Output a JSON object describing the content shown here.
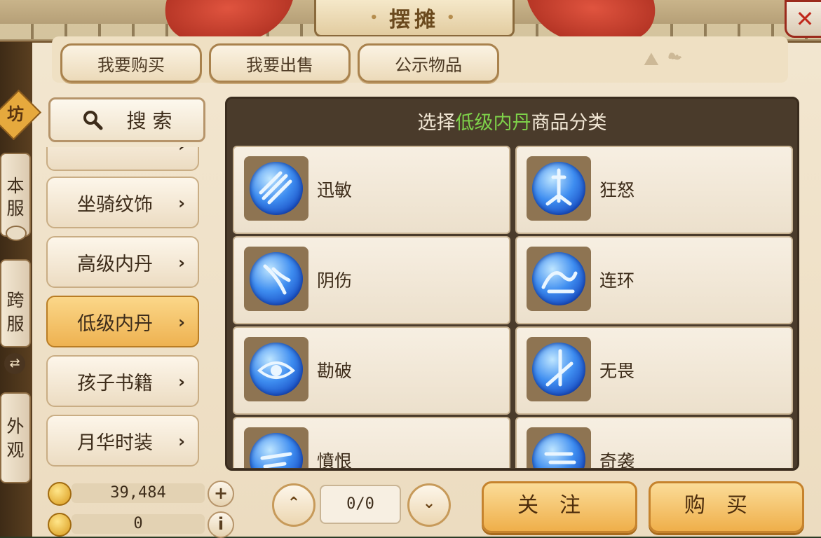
{
  "header": {
    "title": "摆摊",
    "close_symbol": "✕"
  },
  "top_tabs": [
    {
      "label": "我要购买"
    },
    {
      "label": "我要出售"
    },
    {
      "label": "公示物品"
    }
  ],
  "side_tabs": {
    "shop": "坊",
    "local": "本服",
    "cross": "跨服",
    "appearance": "外观"
  },
  "search": {
    "label": "搜 索"
  },
  "categories": [
    {
      "label": "坐骑纹饰"
    },
    {
      "label": "高级内丹"
    },
    {
      "label": "低级内丹"
    },
    {
      "label": "孩子书籍"
    },
    {
      "label": "月华时装"
    }
  ],
  "selected_category": "低级内丹",
  "panel": {
    "prefix": "选择",
    "highlight": "低级内丹",
    "suffix": "商品分类"
  },
  "items": [
    {
      "label": "迅敏",
      "icon": "claw-slash-icon"
    },
    {
      "label": "狂怒",
      "icon": "sword-burst-icon"
    },
    {
      "label": "阴伤",
      "icon": "feather-blade-icon"
    },
    {
      "label": "连环",
      "icon": "swirl-wave-icon"
    },
    {
      "label": "勘破",
      "icon": "eye-icon"
    },
    {
      "label": "无畏",
      "icon": "spear-icon"
    },
    {
      "label": "憤恨",
      "icon": "fist-icon"
    },
    {
      "label": "奇袭",
      "icon": "dash-icon"
    }
  ],
  "currency": [
    {
      "value": "39,484",
      "button": "+"
    },
    {
      "value": "0",
      "button": "i"
    }
  ],
  "pagination": {
    "display": "0/0",
    "up": "⌃",
    "down": "⌄"
  },
  "actions": {
    "follow": "关注",
    "buy": "购买"
  },
  "colors": {
    "highlight": "#7ed24a",
    "active_tab": "#eeb251",
    "panel_bg": "#4a3b2b"
  }
}
